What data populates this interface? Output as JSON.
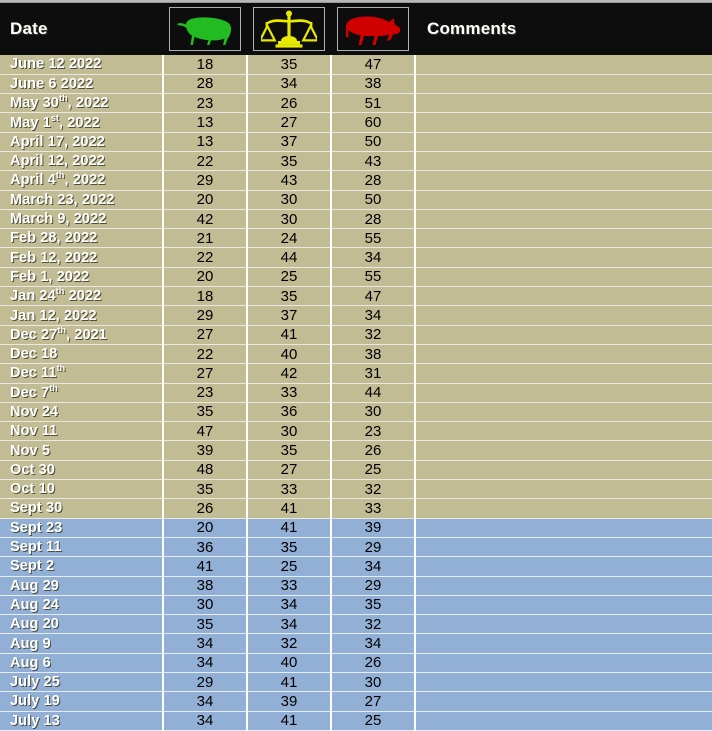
{
  "header": {
    "date_label": "Date",
    "comments_label": "Comments",
    "icons": [
      {
        "name": "bull-icon",
        "semantic": "bullish",
        "color": "#22bb22"
      },
      {
        "name": "scales-icon",
        "semantic": "neutral",
        "color": "#e8e800"
      },
      {
        "name": "bear-icon",
        "semantic": "bearish",
        "color": "#d00000"
      }
    ]
  },
  "colors": {
    "header_background": "#0d0d0d",
    "row_tan": "#c2bc94",
    "row_blue": "#92b0d6",
    "date_text": "#ffffff",
    "number_text": "#000000",
    "grid_line": "#ffffff",
    "bull_green": "#22bb22",
    "neutral_yellow": "#e8e800",
    "bear_red": "#d00000"
  },
  "rows": [
    {
      "date": "June 12 2022",
      "sup": "",
      "date_tail": "",
      "bullish": "18",
      "neutral": "35",
      "bearish": "47",
      "comment": "",
      "band": "tan"
    },
    {
      "date": "June 6 2022",
      "sup": "",
      "date_tail": "",
      "bullish": "28",
      "neutral": "34",
      "bearish": "38",
      "comment": "",
      "band": "tan"
    },
    {
      "date": "May 30",
      "sup": "th",
      "date_tail": ", 2022",
      "bullish": "23",
      "neutral": "26",
      "bearish": "51",
      "comment": "",
      "band": "tan"
    },
    {
      "date": "May 1",
      "sup": "st",
      "date_tail": ", 2022",
      "bullish": "13",
      "neutral": "27",
      "bearish": "60",
      "comment": "",
      "band": "tan"
    },
    {
      "date": "April 17, 2022",
      "sup": "",
      "date_tail": "",
      "bullish": "13",
      "neutral": "37",
      "bearish": "50",
      "comment": "",
      "band": "tan"
    },
    {
      "date": "April 12, 2022",
      "sup": "",
      "date_tail": "",
      "bullish": "22",
      "neutral": "35",
      "bearish": "43",
      "comment": "",
      "band": "tan"
    },
    {
      "date": "April 4",
      "sup": "th",
      "date_tail": ", 2022",
      "bullish": "29",
      "neutral": "43",
      "bearish": "28",
      "comment": "",
      "band": "tan"
    },
    {
      "date": "March 23, 2022",
      "sup": "",
      "date_tail": "",
      "bullish": "20",
      "neutral": "30",
      "bearish": "50",
      "comment": "",
      "band": "tan"
    },
    {
      "date": "March 9, 2022",
      "sup": "",
      "date_tail": "",
      "bullish": "42",
      "neutral": "30",
      "bearish": "28",
      "comment": "",
      "band": "tan"
    },
    {
      "date": "Feb 28, 2022",
      "sup": "",
      "date_tail": "",
      "bullish": "21",
      "neutral": "24",
      "bearish": "55",
      "comment": "",
      "band": "tan"
    },
    {
      "date": "Feb 12, 2022",
      "sup": "",
      "date_tail": "",
      "bullish": "22",
      "neutral": "44",
      "bearish": "34",
      "comment": "",
      "band": "tan"
    },
    {
      "date": "Feb 1, 2022",
      "sup": "",
      "date_tail": "",
      "bullish": "20",
      "neutral": "25",
      "bearish": "55",
      "comment": "",
      "band": "tan"
    },
    {
      "date": "Jan 24",
      "sup": "th",
      "date_tail": " 2022",
      "bullish": "18",
      "neutral": "35",
      "bearish": "47",
      "comment": "",
      "band": "tan"
    },
    {
      "date": "Jan 12, 2022",
      "sup": "",
      "date_tail": "",
      "bullish": "29",
      "neutral": "37",
      "bearish": "34",
      "comment": "",
      "band": "tan"
    },
    {
      "date": "Dec 27",
      "sup": "th",
      "date_tail": ", 2021",
      "bullish": "27",
      "neutral": "41",
      "bearish": "32",
      "comment": "",
      "band": "tan"
    },
    {
      "date": "Dec 18",
      "sup": "",
      "date_tail": "",
      "bullish": "22",
      "neutral": "40",
      "bearish": "38",
      "comment": "",
      "band": "tan"
    },
    {
      "date": "Dec 11",
      "sup": "th",
      "date_tail": "",
      "bullish": "27",
      "neutral": "42",
      "bearish": "31",
      "comment": "",
      "band": "tan"
    },
    {
      "date": "Dec 7",
      "sup": "th",
      "date_tail": "",
      "bullish": "23",
      "neutral": "33",
      "bearish": "44",
      "comment": "",
      "band": "tan"
    },
    {
      "date": "Nov 24",
      "sup": "",
      "date_tail": "",
      "bullish": "35",
      "neutral": "36",
      "bearish": "30",
      "comment": "",
      "band": "tan"
    },
    {
      "date": "Nov 11",
      "sup": "",
      "date_tail": "",
      "bullish": "47",
      "neutral": "30",
      "bearish": "23",
      "comment": "",
      "band": "tan"
    },
    {
      "date": "Nov 5",
      "sup": "",
      "date_tail": "",
      "bullish": "39",
      "neutral": "35",
      "bearish": "26",
      "comment": "",
      "band": "tan"
    },
    {
      "date": "Oct 30",
      "sup": "",
      "date_tail": "",
      "bullish": "48",
      "neutral": "27",
      "bearish": "25",
      "comment": "",
      "band": "tan"
    },
    {
      "date": "Oct 10",
      "sup": "",
      "date_tail": "",
      "bullish": "35",
      "neutral": "33",
      "bearish": "32",
      "comment": "",
      "band": "tan"
    },
    {
      "date": "Sept 30",
      "sup": "",
      "date_tail": "",
      "bullish": "26",
      "neutral": "41",
      "bearish": "33",
      "comment": "",
      "band": "tan"
    },
    {
      "date": "Sept 23",
      "sup": "",
      "date_tail": "",
      "bullish": "20",
      "neutral": "41",
      "bearish": "39",
      "comment": "",
      "band": "blue"
    },
    {
      "date": "Sept 11",
      "sup": "",
      "date_tail": "",
      "bullish": "36",
      "neutral": "35",
      "bearish": "29",
      "comment": "",
      "band": "blue"
    },
    {
      "date": "Sept 2",
      "sup": "",
      "date_tail": "",
      "bullish": "41",
      "neutral": "25",
      "bearish": "34",
      "comment": "",
      "band": "blue"
    },
    {
      "date": "Aug 29",
      "sup": "",
      "date_tail": "",
      "bullish": "38",
      "neutral": "33",
      "bearish": "29",
      "comment": "",
      "band": "blue"
    },
    {
      "date": "Aug 24",
      "sup": "",
      "date_tail": "",
      "bullish": "30",
      "neutral": "34",
      "bearish": "35",
      "comment": "",
      "band": "blue"
    },
    {
      "date": "Aug 20",
      "sup": "",
      "date_tail": "",
      "bullish": "35",
      "neutral": "34",
      "bearish": "32",
      "comment": "",
      "band": "blue"
    },
    {
      "date": "Aug 9",
      "sup": "",
      "date_tail": "",
      "bullish": "34",
      "neutral": "32",
      "bearish": "34",
      "comment": "",
      "band": "blue"
    },
    {
      "date": "Aug 6",
      "sup": "",
      "date_tail": "",
      "bullish": "34",
      "neutral": "40",
      "bearish": "26",
      "comment": "",
      "band": "blue"
    },
    {
      "date": "July 25",
      "sup": "",
      "date_tail": "",
      "bullish": "29",
      "neutral": "41",
      "bearish": "30",
      "comment": "",
      "band": "blue"
    },
    {
      "date": "July 19",
      "sup": "",
      "date_tail": "",
      "bullish": "34",
      "neutral": "39",
      "bearish": "27",
      "comment": "",
      "band": "blue"
    },
    {
      "date": "July 13",
      "sup": "",
      "date_tail": "",
      "bullish": "34",
      "neutral": "41",
      "bearish": "25",
      "comment": "",
      "band": "blue"
    }
  ]
}
